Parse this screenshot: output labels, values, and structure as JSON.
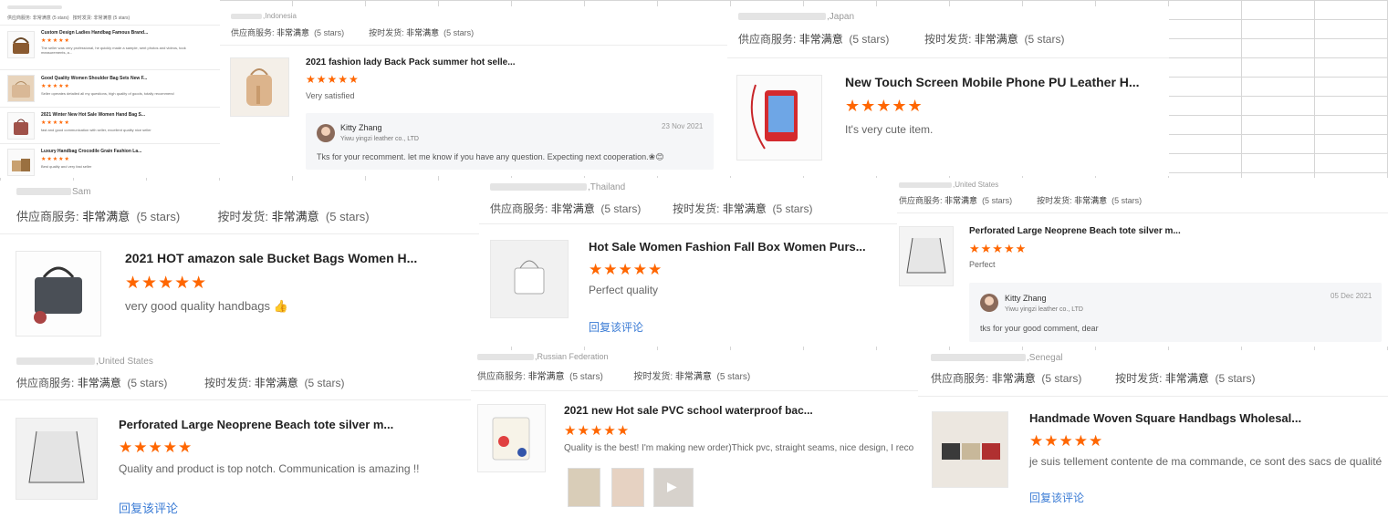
{
  "labels": {
    "supplier_service": "供应商服务:",
    "on_time": "按时发货:",
    "very_satisfied": "非常满意",
    "five_stars": "(5 stars)",
    "reply_review": "回复该评论",
    "stars": "★★★★★"
  },
  "card0": {
    "items": [
      {
        "title": "Custom Design Ladies Handbag Famous Brand...",
        "comment": "The seller was very professional, he quickly made a sample, sent photos and videos, took measurements, a..."
      },
      {
        "title": "Good Quality Women Shoulder Bag Sets New F...",
        "comment": "Seller operates detailed all my questions, high quality of goods, totally recommend"
      },
      {
        "title": "2021 Winter New Hot Sale Women Hand Bag S...",
        "comment": "fast and good communication with seller, excellent quality nice seller"
      },
      {
        "title": "Luxury Handbag Crocodile Grain Fashion La...",
        "comment": "Best quality and very fast seller"
      }
    ]
  },
  "card1": {
    "country": ",Indonesia",
    "title": "2021 fashion lady Back Pack summer hot selle...",
    "comment": "Very satisfied",
    "reply": {
      "name": "Kitty Zhang",
      "company": "Yiwu yingzi leather co., LTD",
      "date": "23 Nov 2021",
      "text": "Tks for your recomment. let me know if you have any question. Expecting next cooperation.❀😊"
    }
  },
  "card2": {
    "country": ",Japan",
    "title": "New Touch Screen Mobile Phone PU Leather H...",
    "comment": "It's very cute item."
  },
  "card3": {
    "country": "Sam",
    "title": "2021 HOT amazon sale Bucket Bags Women H...",
    "comment": "very good quality handbags 👍"
  },
  "card4": {
    "country": ",Thailand",
    "title": "Hot Sale Women Fashion Fall Box Women Purs...",
    "comment": "Perfect quality"
  },
  "card5": {
    "country": ",United States",
    "title": "Perforated Large Neoprene Beach tote silver m...",
    "comment": "Perfect",
    "reply": {
      "name": "Kitty Zhang",
      "company": "Yiwu yingzi leather co., LTD",
      "date": "05 Dec 2021",
      "text": "tks for your good comment, dear"
    }
  },
  "card6": {
    "country": ",United States",
    "title": "Perforated Large Neoprene Beach tote silver m...",
    "comment": "Quality and product is top notch. Communication is amazing !!"
  },
  "card7": {
    "country": ",Russian Federation",
    "title": "2021 new Hot sale PVC school waterproof bac...",
    "comment": "Quality is the best! I'm making new order)Thick pvc, straight seams, nice design, I reco"
  },
  "card8": {
    "country": ",Senegal",
    "title": "Handmade Woven Square Handbags Wholesal...",
    "comment": "je suis tellement contente de ma commande, ce sont des sacs de qualité"
  },
  "colors": {
    "star": "#ff6600",
    "link": "#3a7bd5"
  },
  "icons": {
    "avatar": "seller-avatar-icon",
    "play": "play-icon"
  }
}
